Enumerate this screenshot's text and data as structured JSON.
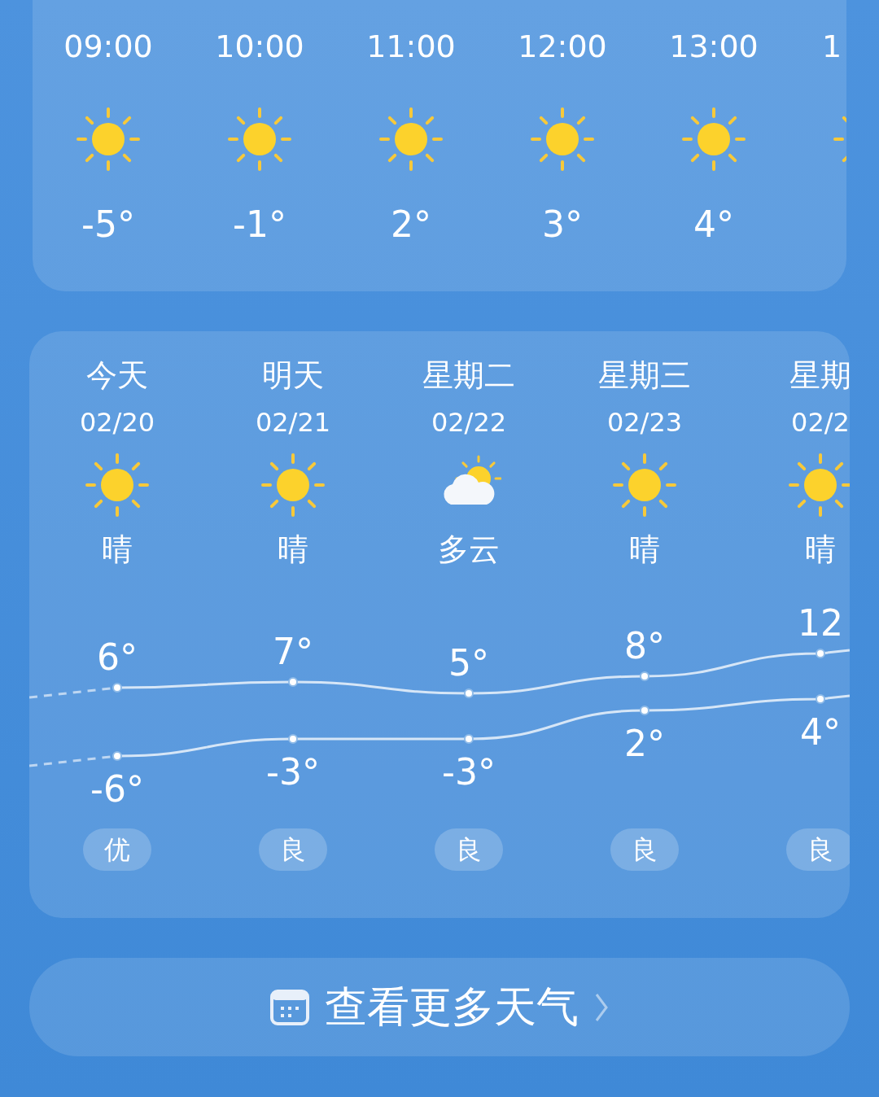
{
  "hourly": [
    {
      "time": "09:00",
      "kind": "sun",
      "temp": "-5°"
    },
    {
      "time": "10:00",
      "kind": "sun",
      "temp": "-1°"
    },
    {
      "time": "11:00",
      "kind": "sun",
      "temp": "2°"
    },
    {
      "time": "12:00",
      "kind": "sun",
      "temp": "3°"
    },
    {
      "time": "13:00",
      "kind": "sun",
      "temp": "4°"
    },
    {
      "time": "1",
      "kind": "sun"
    }
  ],
  "daily": [
    {
      "day": "今天",
      "date": "02/20",
      "kind": "sun",
      "condition": "晴",
      "high": "6°",
      "low": "-6°",
      "aqi": "优"
    },
    {
      "day": "明天",
      "date": "02/21",
      "kind": "sun",
      "condition": "晴",
      "high": "7°",
      "low": "-3°",
      "aqi": "良"
    },
    {
      "day": "星期二",
      "date": "02/22",
      "kind": "cloud",
      "condition": "多云",
      "high": "5°",
      "low": "-3°",
      "aqi": "良"
    },
    {
      "day": "星期三",
      "date": "02/23",
      "kind": "sun",
      "condition": "晴",
      "high": "8°",
      "low": "2°",
      "aqi": "良"
    },
    {
      "day": "星期",
      "date": "02/2",
      "kind": "sun",
      "condition": "晴",
      "high": "12",
      "low": "4°",
      "aqi": "良"
    }
  ],
  "more_button": {
    "label": "查看更多天气"
  }
}
